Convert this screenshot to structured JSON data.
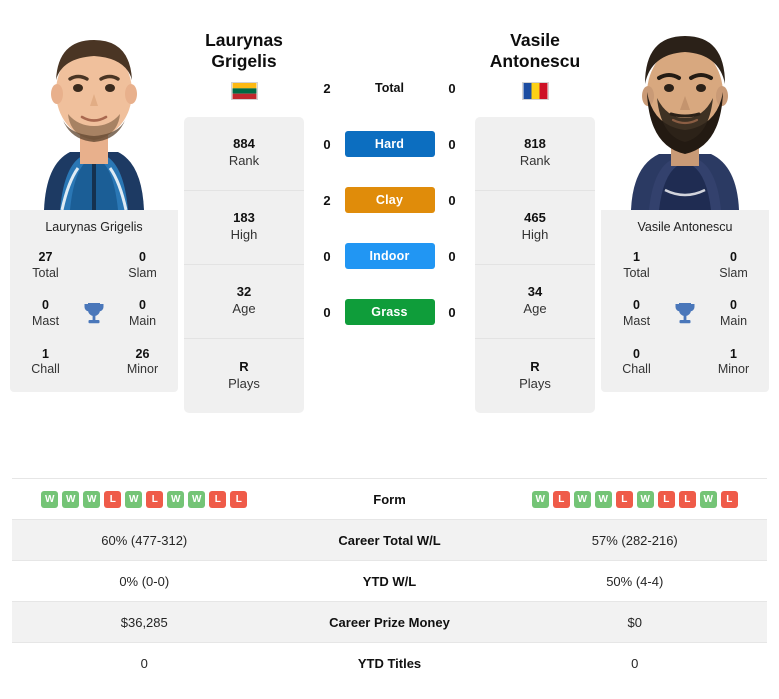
{
  "players": {
    "left": {
      "name_line1": "Laurynas",
      "name_line2": "Grigelis",
      "full_name": "Laurynas Grigelis",
      "country": "Lithuania",
      "flag": "lithuania-flag",
      "rank_value": "884",
      "rank_label": "Rank",
      "high_value": "183",
      "high_label": "High",
      "age_value": "32",
      "age_label": "Age",
      "plays_value": "R",
      "plays_label": "Plays",
      "titles": {
        "total_value": "27",
        "total_label": "Total",
        "slam_value": "0",
        "slam_label": "Slam",
        "mast_value": "0",
        "mast_label": "Mast",
        "main_value": "0",
        "main_label": "Main",
        "chall_value": "1",
        "chall_label": "Chall",
        "minor_value": "26",
        "minor_label": "Minor"
      },
      "form": [
        "W",
        "W",
        "W",
        "L",
        "W",
        "L",
        "W",
        "W",
        "L",
        "L"
      ],
      "career_total_wl": "60% (477-312)",
      "ytd_wl": "0% (0-0)",
      "career_prize_money": "$36,285",
      "ytd_titles": "0"
    },
    "right": {
      "name_line1": "Vasile",
      "name_line2": "Antonescu",
      "full_name": "Vasile Antonescu",
      "country": "Romania",
      "flag": "romania-flag",
      "rank_value": "818",
      "rank_label": "Rank",
      "high_value": "465",
      "high_label": "High",
      "age_value": "34",
      "age_label": "Age",
      "plays_value": "R",
      "plays_label": "Plays",
      "titles": {
        "total_value": "1",
        "total_label": "Total",
        "slam_value": "0",
        "slam_label": "Slam",
        "mast_value": "0",
        "mast_label": "Mast",
        "main_value": "0",
        "main_label": "Main",
        "chall_value": "0",
        "chall_label": "Chall",
        "minor_value": "1",
        "minor_label": "Minor"
      },
      "form": [
        "W",
        "L",
        "W",
        "W",
        "L",
        "W",
        "L",
        "L",
        "W",
        "L"
      ],
      "career_total_wl": "57% (282-216)",
      "ytd_wl": "50% (4-4)",
      "career_prize_money": "$0",
      "ytd_titles": "0"
    }
  },
  "h2h": {
    "total": {
      "label": "Total",
      "left": "2",
      "right": "0"
    },
    "surfaces": [
      {
        "label": "Hard",
        "left": "0",
        "right": "0",
        "color": "#0c6ec0"
      },
      {
        "label": "Clay",
        "left": "2",
        "right": "0",
        "color": "#e08c0a"
      },
      {
        "label": "Indoor",
        "left": "0",
        "right": "0",
        "color": "#2196f3"
      },
      {
        "label": "Grass",
        "left": "0",
        "right": "0",
        "color": "#0f9d3a"
      }
    ]
  },
  "table": {
    "rows": [
      {
        "label": "Form",
        "type": "form"
      },
      {
        "label": "Career Total W/L",
        "type": "text",
        "left": "60% (477-312)",
        "right": "57% (282-216)"
      },
      {
        "label": "YTD W/L",
        "type": "text",
        "left": "0% (0-0)",
        "right": "50% (4-4)"
      },
      {
        "label": "Career Prize Money",
        "type": "text",
        "left": "$36,285",
        "right": "$0"
      },
      {
        "label": "YTD Titles",
        "type": "text",
        "left": "0",
        "right": "0"
      }
    ]
  },
  "colors": {
    "win": "#74c476",
    "loss": "#ef5b49",
    "trophy": "#4a77ba",
    "panel": "#f0f0f0"
  }
}
